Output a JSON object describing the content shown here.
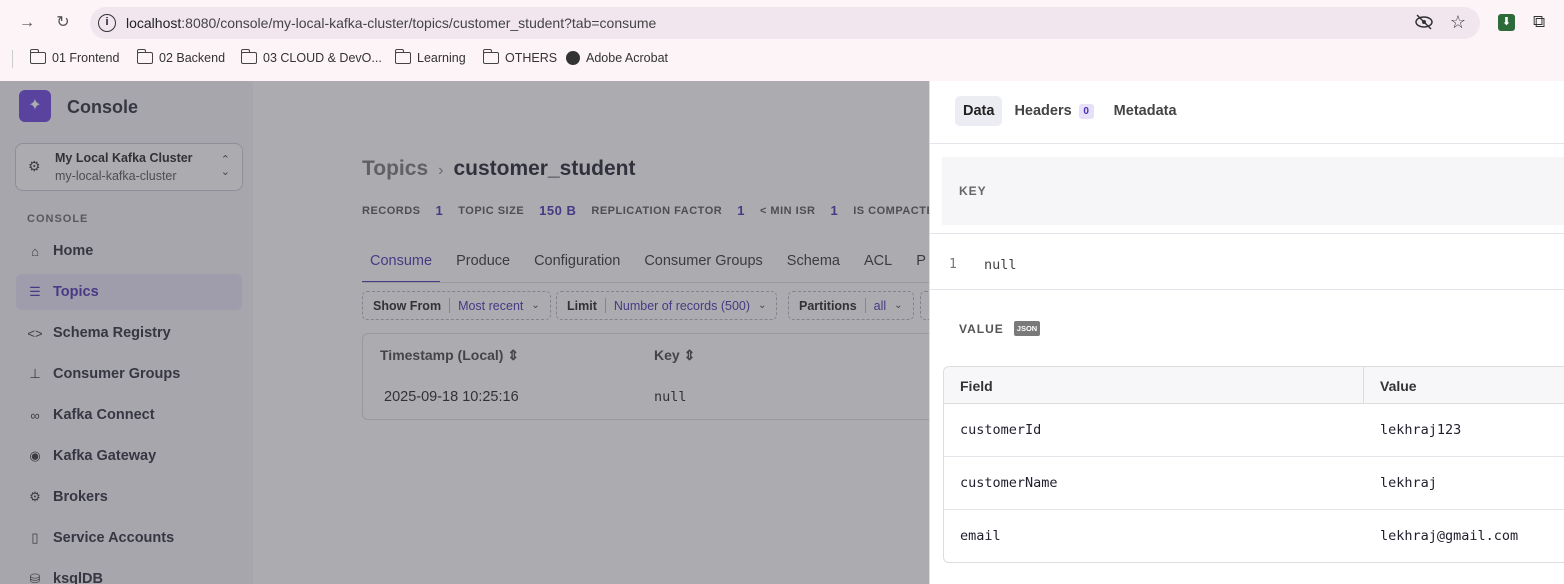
{
  "browser": {
    "url_host": "localhost",
    "url_rest": ":8080/console/my-local-kafka-cluster/topics/customer_student?tab=consume",
    "bookmarks": [
      "01 Frontend",
      "02 Backend",
      "03 CLOUD & DevO...",
      "Learning",
      "OTHERS",
      "Adobe Acrobat"
    ]
  },
  "sidebar": {
    "brand": "Console",
    "cluster_name": "My Local Kafka Cluster",
    "cluster_id": "my-local-kafka-cluster",
    "section_label": "CONSOLE",
    "items": [
      {
        "label": "Home",
        "icon": "home-icon"
      },
      {
        "label": "Topics",
        "icon": "topics-icon",
        "active": true
      },
      {
        "label": "Schema Registry",
        "icon": "code-icon"
      },
      {
        "label": "Consumer Groups",
        "icon": "hierarchy-icon"
      },
      {
        "label": "Kafka Connect",
        "icon": "connect-icon"
      },
      {
        "label": "Kafka Gateway",
        "icon": "gateway-icon"
      },
      {
        "label": "Brokers",
        "icon": "gear-icon"
      },
      {
        "label": "Service Accounts",
        "icon": "lock-file-icon"
      },
      {
        "label": "ksqlDB",
        "icon": "database-icon"
      }
    ]
  },
  "main": {
    "breadcrumb_parent": "Topics",
    "breadcrumb_current": "customer_student",
    "stats": [
      {
        "label": "RECORDS",
        "value": "1"
      },
      {
        "label": "TOPIC SIZE",
        "value": "150 B"
      },
      {
        "label": "REPLICATION FACTOR",
        "value": "1"
      },
      {
        "label": "< MIN ISR",
        "value": "1"
      },
      {
        "label": "IS COMPACTED",
        "value": ""
      }
    ],
    "tabs": [
      "Consume",
      "Produce",
      "Configuration",
      "Consumer Groups",
      "Schema",
      "ACL",
      "P"
    ],
    "filters": [
      {
        "label": "Show From",
        "value": "Most recent"
      },
      {
        "label": "Limit",
        "value": "Number of records (500)"
      },
      {
        "label": "Partitions",
        "value": "all"
      }
    ],
    "table": {
      "headers": [
        "Timestamp (Local)",
        "Key"
      ],
      "rows": [
        [
          "2025-09-18 10:25:16",
          "null"
        ]
      ]
    }
  },
  "drawer": {
    "tabs": [
      "Data",
      "Headers",
      "Metadata"
    ],
    "headers_count": "0",
    "key_label": "KEY",
    "key_line_number": "1",
    "key_value": "null",
    "value_label": "VALUE",
    "value_format": "JSON",
    "value_table": {
      "headers": [
        "Field",
        "Value"
      ],
      "rows": [
        [
          "customerId",
          "lekhraj123"
        ],
        [
          "customerName",
          "lekhraj"
        ],
        [
          "email",
          "lekhraj@gmail.com"
        ]
      ]
    }
  },
  "colors": {
    "accent": "#4a2fb0",
    "brand": "#6b3fe0"
  }
}
